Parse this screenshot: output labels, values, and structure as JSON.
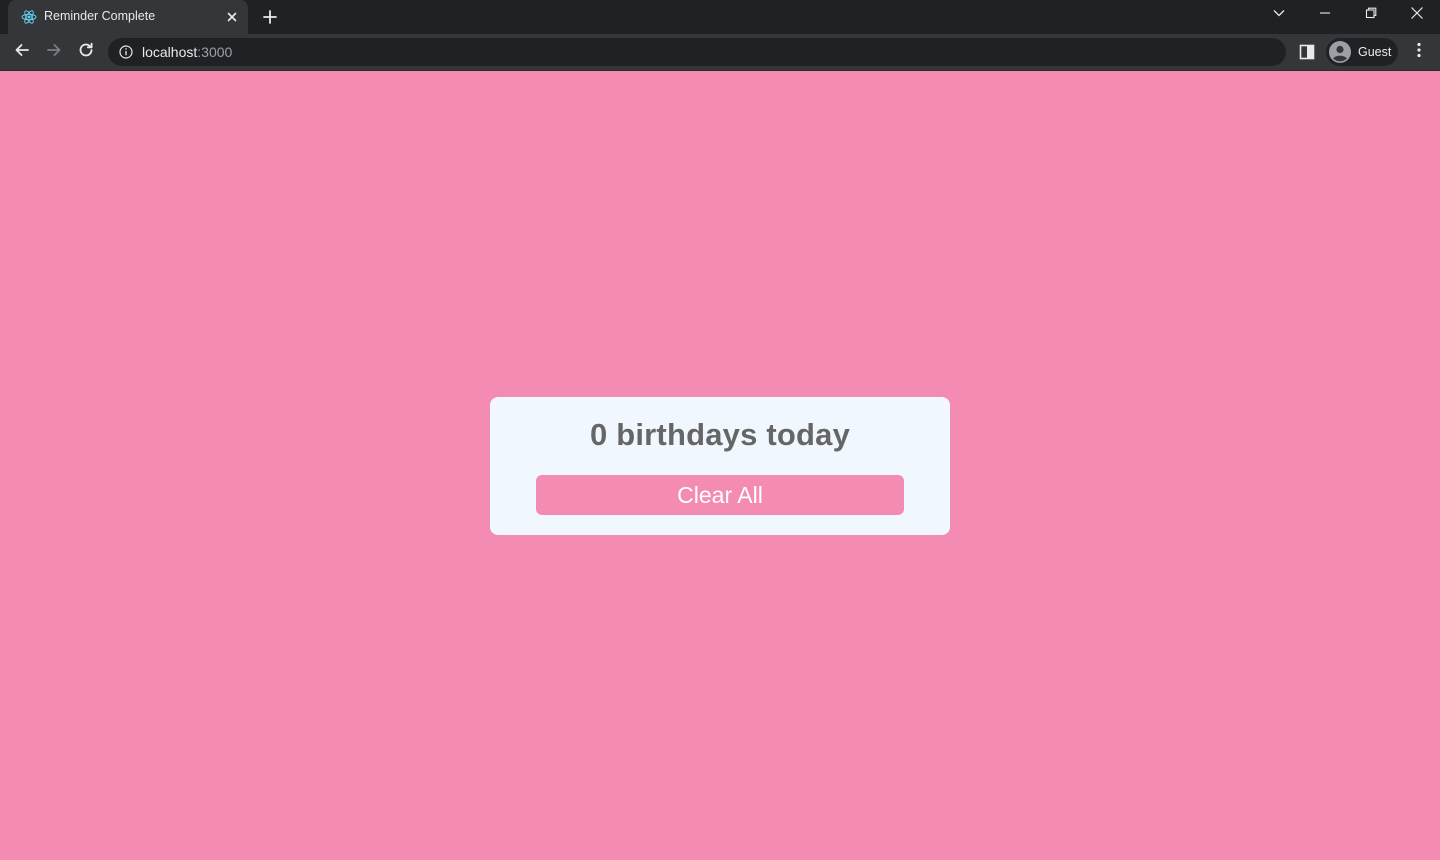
{
  "browser": {
    "tab": {
      "title": "Reminder Complete"
    },
    "address": {
      "host": "localhost",
      "port": ":3000"
    },
    "profile": {
      "label": "Guest"
    }
  },
  "icons": {
    "favicon": "react-logo-icon",
    "tab_close": "close-icon",
    "new_tab": "plus-icon",
    "tab_search": "chevron-down-icon",
    "minimize": "minimize-icon",
    "restore": "restore-icon",
    "close_window": "close-icon",
    "back": "arrow-left-icon",
    "forward": "arrow-right-icon",
    "reload": "reload-icon",
    "site_info": "info-icon",
    "side_panel": "side-panel-icon",
    "profile": "avatar-icon",
    "menu": "kebab-menu-icon"
  },
  "colors": {
    "page_background": "#f48bb2",
    "card_background": "#f0f7ff",
    "title_text": "#666666",
    "button_background": "#f48bb2",
    "button_text": "#ffffff"
  },
  "main": {
    "title": "0 birthdays today",
    "clear_button_label": "Clear All"
  }
}
